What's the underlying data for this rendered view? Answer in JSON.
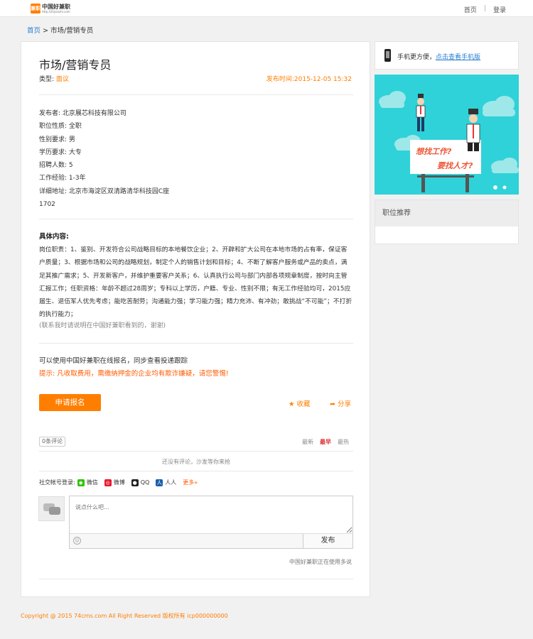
{
  "header": {
    "logo_mark": "兼职",
    "logo_name": "中国好兼职",
    "logo_url": "http://zhjianzhi.com",
    "nav": [
      "首页",
      "登录"
    ],
    "nav_sep": "|"
  },
  "breadcrumb": {
    "home": "首页",
    "sep": " > ",
    "current": "市场/营销专员"
  },
  "job": {
    "title": "市场/营销专员",
    "type_label": "类型: ",
    "type_value": "面议",
    "pubtime": "发布时间:2015-12-05 15:32",
    "info": [
      "发布者: 北京展芯科技有限公司",
      "职位性质: 全职",
      "性别要求: 男",
      "学历要求: 大专",
      "招聘人数: 5",
      "工作经验: 1-3年",
      "详细地址: 北京市海淀区双清路清华科技园C座",
      "1702"
    ],
    "content_title": "具体内容:",
    "content_body": "岗位职责：1、鉴别、开发符合公司战略目标的本地餐饮企业；2、开辟和扩大公司在本地市场的占有率，保证客户质量；3、根据市场和公司的战略规划，制定个人的销售计划和目标；4、不断了解客户服务或产品的卖点，满足其推广需求；5、开发新客户，并维护重要客户关系；6、认真执行公司与部门内部各项规章制度，按时向主管汇报工作；任职资格：年龄不超过28周岁；专科以上学历，户籍、专业、性别不限；有无工作经验均可，2015应届生、退伍军人优先考虑；能吃苦耐劳；沟通能力强；学习能力强；精力充沛、有冲劲；敢挑战“不可能”；不打折的执行能力；",
    "content_note": "(联系我时请说明在中国好兼职看到的，谢谢)",
    "apply_line": "可以使用中国好兼职在线报名，同步查看投递跟踪",
    "tip_line": "提示: 凡收取费用，需缴纳押金的企业均有欺诈嫌疑，请您警惕!",
    "apply_button": "申请报名",
    "fav": "★ 收藏",
    "share": "➦ 分享"
  },
  "comments": {
    "count": "0条评论",
    "sort": [
      "最新",
      "最早",
      "最热"
    ],
    "sort_active": 1,
    "empty": "还没有评论，沙发等你来抢",
    "social_label": "社交帐号登录:",
    "social": [
      {
        "label": "微信",
        "icon": "wechat-icon",
        "color": "#2dc100",
        "glyph": "◉"
      },
      {
        "label": "微博",
        "icon": "weibo-icon",
        "color": "#e6162d",
        "glyph": "◎"
      },
      {
        "label": "QQ",
        "icon": "qq-icon",
        "color": "#222222",
        "glyph": "●"
      },
      {
        "label": "人人",
        "icon": "renren-icon",
        "color": "#1b5fac",
        "glyph": "人"
      }
    ],
    "more": "更多»",
    "placeholder": "说点什么吧…",
    "submit": "发布",
    "powered": "中国好兼职正在使用多说"
  },
  "sidebar": {
    "mobile_text": "手机更方便，",
    "mobile_link": "点击查看手机版",
    "banner": {
      "line1": "想找工作?",
      "line2": "要找人才?"
    },
    "rec_title": "职位推荐"
  },
  "footer": "Copyright @ 2015 74cms.com All Right Reserved 版权所有 icp000000000",
  "colors": {
    "accent": "#ff7e00",
    "link": "#2b7fd1",
    "banner": "#2fd2d8",
    "warning": "#ff5a00"
  }
}
